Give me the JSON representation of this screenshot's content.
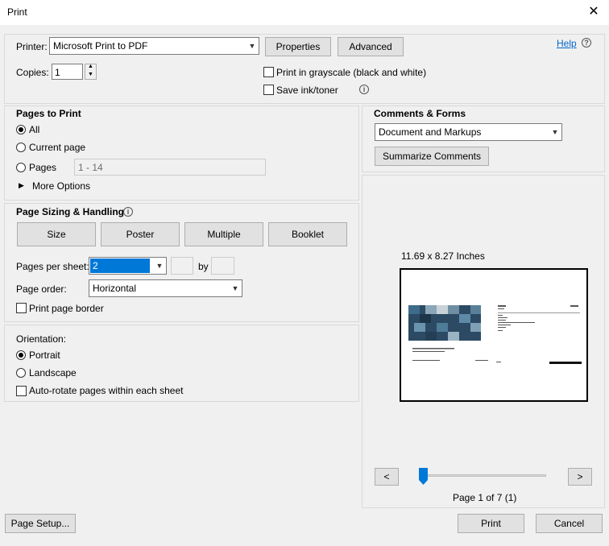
{
  "window": {
    "title": "Print"
  },
  "printer": {
    "label": "Printer:",
    "selected": "Microsoft Print to PDF",
    "properties_label": "Properties",
    "advanced_label": "Advanced",
    "help_label": "Help",
    "copies_label": "Copies:",
    "copies_value": "1",
    "grayscale_label": "Print in grayscale (black and white)",
    "save_ink_label": "Save ink/toner"
  },
  "pages_to_print": {
    "title": "Pages to Print",
    "all_label": "All",
    "current_label": "Current page",
    "pages_label": "Pages",
    "pages_value": "1 - 14",
    "more_options_label": "More Options"
  },
  "sizing": {
    "title": "Page Sizing & Handling",
    "tabs": [
      "Size",
      "Poster",
      "Multiple",
      "Booklet"
    ],
    "pages_per_sheet_label": "Pages per sheet:",
    "pages_per_sheet_value": "2",
    "by_label": "by",
    "page_order_label": "Page order:",
    "page_order_value": "Horizontal",
    "border_label": "Print page border"
  },
  "orientation": {
    "title": "Orientation:",
    "portrait_label": "Portrait",
    "landscape_label": "Landscape",
    "autorotate_label": "Auto-rotate pages within each sheet"
  },
  "comments": {
    "title": "Comments & Forms",
    "selected": "Document and Markups",
    "summarize_label": "Summarize Comments"
  },
  "preview": {
    "size_text": "11.69 x 8.27 Inches",
    "prev_label": "<",
    "next_label": ">",
    "page_text": "Page 1 of 7 (1)",
    "slider_position": 0.0
  },
  "footer": {
    "page_setup_label": "Page Setup...",
    "print_label": "Print",
    "cancel_label": "Cancel"
  },
  "colors": {
    "accent": "#0078d7",
    "selection": "#0078d7",
    "link": "#0066cc"
  }
}
